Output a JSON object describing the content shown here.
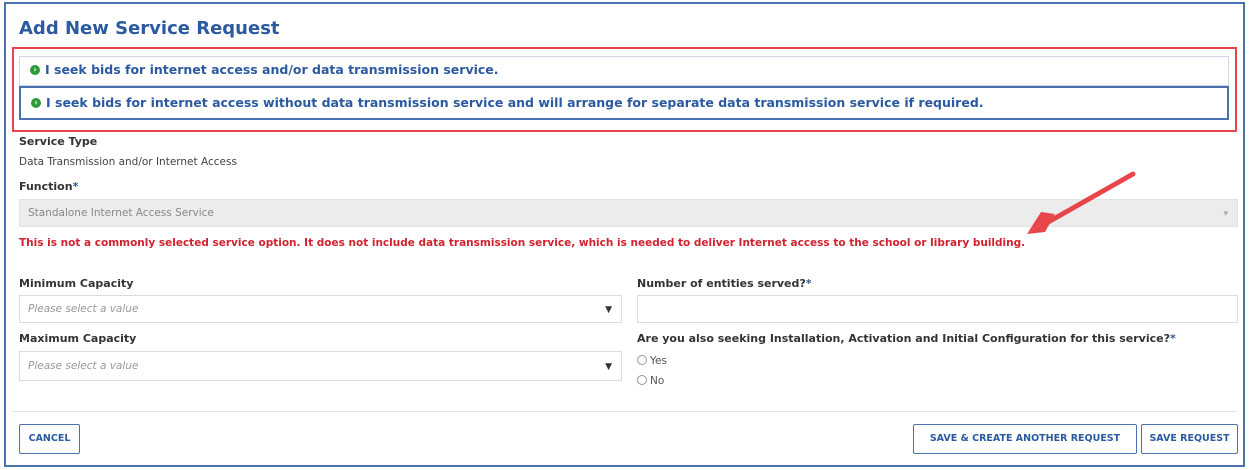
{
  "page": {
    "title": "Add New Service Request"
  },
  "options": [
    "I seek bids for internet access and/or data transmission service.",
    "I seek bids for internet access without data transmission service and will arrange for separate data transmission service if required."
  ],
  "service_type": {
    "label": "Service Type",
    "value": "Data Transmission and/or Internet Access"
  },
  "function": {
    "label": "Function",
    "required_mark": "*",
    "value": "Standalone Internet Access Service",
    "warning": "This is not a commonly selected service option.  It does not include data transmission service, which is needed to deliver Internet access to the school or library building."
  },
  "min_capacity": {
    "label": "Minimum Capacity",
    "placeholder": "Please select a value"
  },
  "max_capacity": {
    "label": "Maximum Capacity",
    "placeholder": "Please select a value"
  },
  "entities": {
    "label": "Number of entities served?",
    "required_mark": "*",
    "value": ""
  },
  "installation": {
    "label": "Are you also seeking Installation, Activation and Initial Configuration for this service?",
    "required_mark": "*",
    "options": [
      "Yes",
      "No"
    ]
  },
  "buttons": {
    "cancel": "CANCEL",
    "save_another": "SAVE & CREATE ANOTHER REQUEST",
    "save": "SAVE REQUEST"
  },
  "colors": {
    "accent": "#2b5aa0",
    "warning": "#d1222f",
    "highlight_box": "#e8454b",
    "option_bullet": "#2e9b3a"
  },
  "icons": {
    "option_bullet": "circle-chevron-right-icon",
    "dropdown": "caret-down-icon",
    "annotation": "red-arrow-icon"
  }
}
